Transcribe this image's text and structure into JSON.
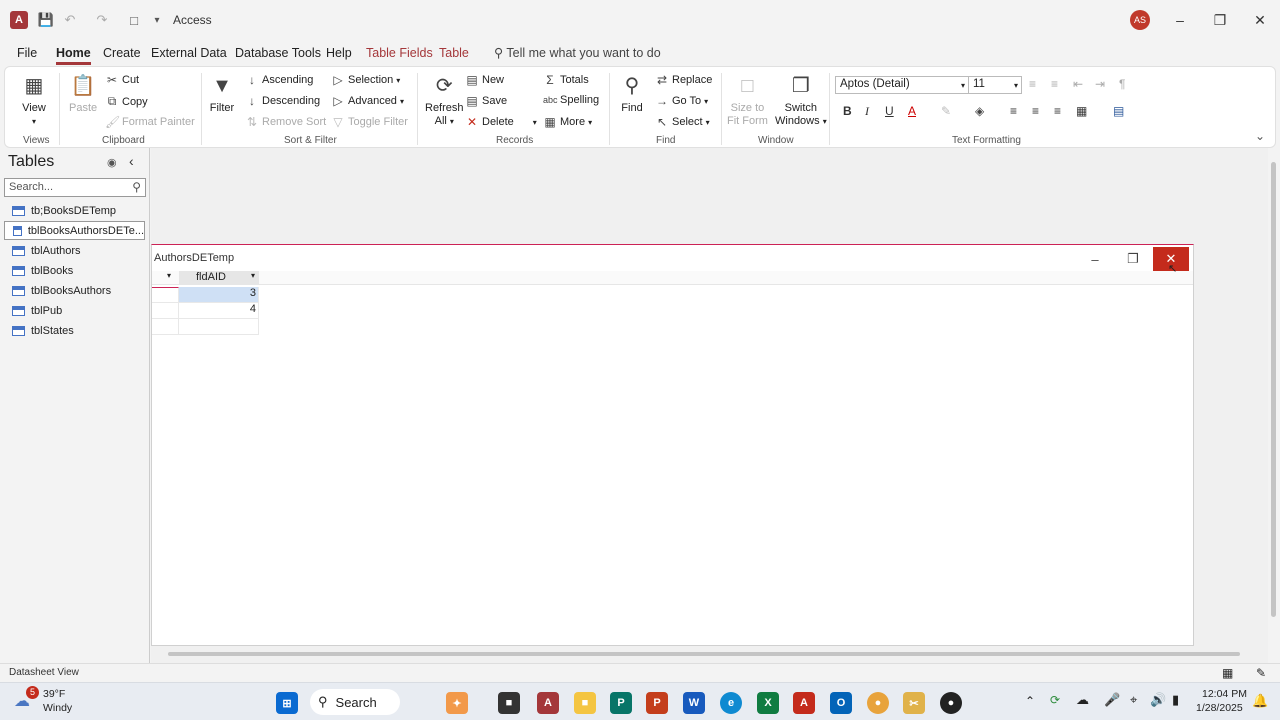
{
  "window": {
    "title": "Access",
    "avatar_initials": "AS"
  },
  "menu": {
    "tabs": [
      "File",
      "Home",
      "Create",
      "External Data",
      "Database Tools",
      "Help",
      "Table Fields",
      "Table"
    ],
    "tell_me": "Tell me what you want to do"
  },
  "ribbon": {
    "views": {
      "view": "View",
      "label": "Views"
    },
    "clipboard": {
      "paste": "Paste",
      "cut": "Cut",
      "copy": "Copy",
      "format_painter": "Format Painter",
      "label": "Clipboard"
    },
    "sort_filter": {
      "filter": "Filter",
      "ascending": "Ascending",
      "descending": "Descending",
      "remove_sort": "Remove Sort",
      "selection": "Selection",
      "advanced": "Advanced",
      "toggle_filter": "Toggle Filter",
      "label": "Sort & Filter"
    },
    "records": {
      "refresh": "Refresh",
      "refresh_all": "All",
      "new": "New",
      "save": "Save",
      "delete": "Delete",
      "totals": "Totals",
      "spelling": "Spelling",
      "more": "More",
      "label": "Records"
    },
    "find": {
      "find": "Find",
      "replace": "Replace",
      "goto": "Go To",
      "select": "Select",
      "label": "Find"
    },
    "window": {
      "size_to": "Size to",
      "fit_form": "Fit Form",
      "switch": "Switch",
      "windows": "Windows",
      "label": "Window"
    },
    "text_formatting": {
      "font": "Aptos (Detail)",
      "size": "11",
      "bold": "B",
      "italic": "I",
      "underline": "U",
      "label": "Text Formatting"
    }
  },
  "nav": {
    "title": "Tables",
    "search_placeholder": "Search...",
    "items": [
      "tb;BooksDETemp",
      "tblBooksAuthorsDETe...",
      "tblAuthors",
      "tblBooks",
      "tblBooksAuthors",
      "tblPub",
      "tblStates"
    ]
  },
  "document": {
    "title": "AuthorsDETemp",
    "column": "fldAID",
    "rows": [
      "3",
      "4"
    ]
  },
  "status": {
    "text": "Datasheet View"
  },
  "taskbar": {
    "weather_temp": "39°F",
    "weather_cond": "Windy",
    "weather_badge": "5",
    "search": "Search",
    "time": "12:04 PM",
    "date": "1/28/2025"
  }
}
